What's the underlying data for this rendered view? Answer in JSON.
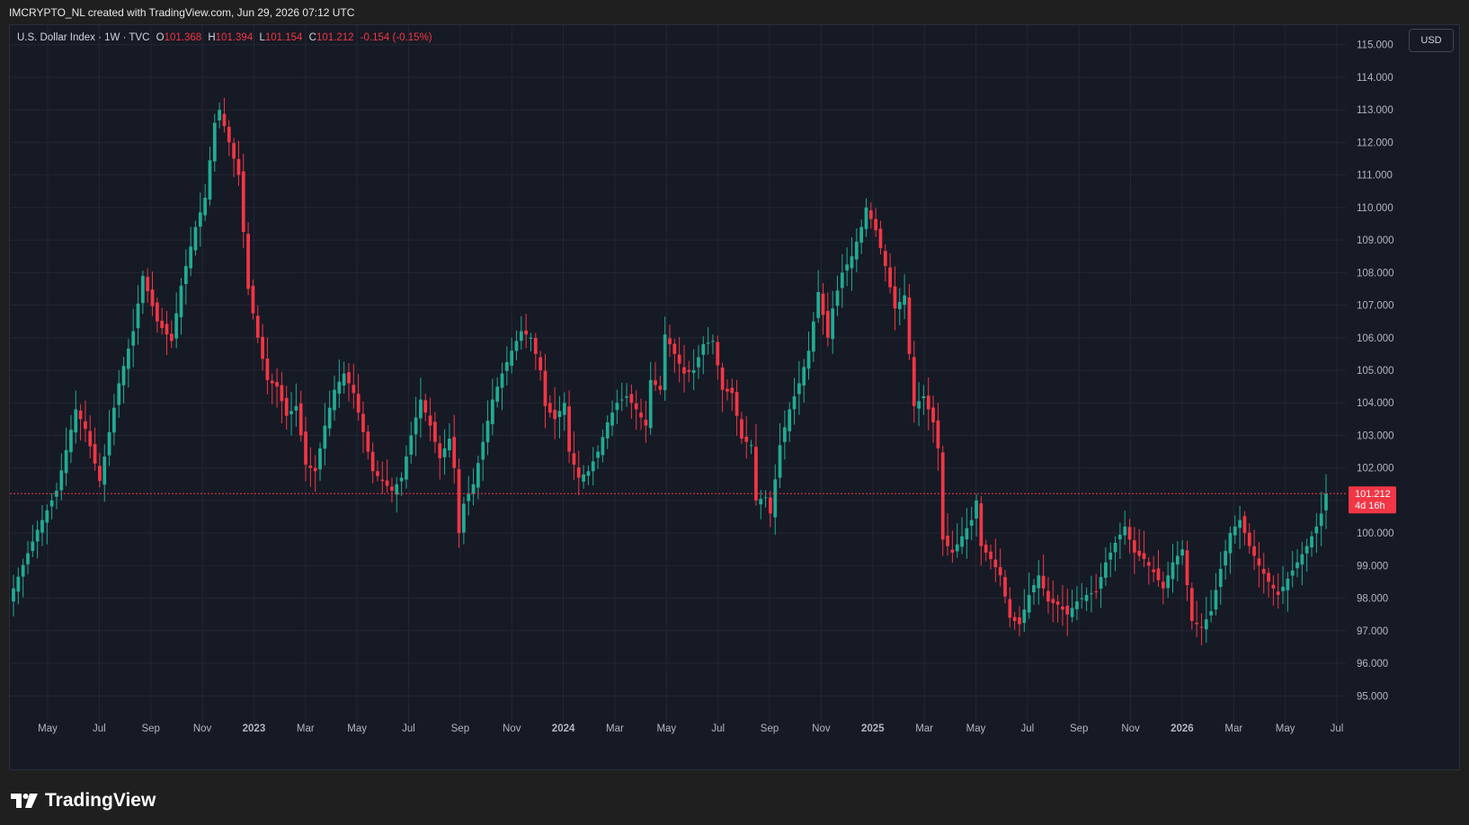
{
  "caption": "IMCRYPTO_NL created with TradingView.com, Jun 29, 2026 07:12 UTC",
  "legend": {
    "symbol": "U.S. Dollar Index · 1W · TVC",
    "open_label": "O",
    "open": "101.368",
    "high_label": "H",
    "high": "101.394",
    "low_label": "L",
    "low": "101.154",
    "close_label": "C",
    "close": "101.212",
    "change": "-0.154 (-0.15%)"
  },
  "currency_button": "USD",
  "price_tag": {
    "price": "101.212",
    "countdown": "4d 16h"
  },
  "logo_text": "TradingView",
  "colors": {
    "up": "#22ab94",
    "down": "#f23645",
    "background": "#161a25",
    "grid": "#232734",
    "axis_text": "#b2b5be"
  },
  "icons": {
    "logo": "tradingview-logo-icon"
  },
  "chart_data": {
    "type": "candlestick",
    "interval": "1W",
    "y_range": [
      94.4,
      115.6
    ],
    "y_ticks": [
      "95.000",
      "96.000",
      "97.000",
      "98.000",
      "99.000",
      "100.000",
      "101.000",
      "102.000",
      "103.000",
      "104.000",
      "105.000",
      "106.000",
      "107.000",
      "108.000",
      "109.000",
      "110.000",
      "111.000",
      "112.000",
      "113.000",
      "114.000",
      "115.000"
    ],
    "x_ticks": [
      "May",
      "Jul",
      "Sep",
      "Nov",
      "2023",
      "Mar",
      "May",
      "Jul",
      "Sep",
      "Nov",
      "2024",
      "Mar",
      "May",
      "Jul",
      "Sep",
      "Nov",
      "2025",
      "Mar",
      "May",
      "Jul",
      "Sep",
      "Nov",
      "2026",
      "Mar",
      "May",
      "Jul"
    ],
    "bold_ticks": [
      "2023",
      "2024",
      "2025",
      "2026"
    ],
    "current_price": 101.212,
    "close_path": [
      [
        0,
        98.3
      ],
      [
        5,
        100.1
      ],
      [
        9,
        101.3
      ],
      [
        13,
        103.8
      ],
      [
        15,
        103.2
      ],
      [
        18,
        101.6
      ],
      [
        22,
        104.6
      ],
      [
        25,
        106.2
      ],
      [
        27,
        107.9
      ],
      [
        30,
        106.5
      ],
      [
        33,
        105.9
      ],
      [
        35,
        107.6
      ],
      [
        38,
        109.4
      ],
      [
        40,
        110.3
      ],
      [
        42,
        112.6
      ],
      [
        43,
        113.0
      ],
      [
        45,
        112.0
      ],
      [
        47,
        111.0
      ],
      [
        49,
        107.5
      ],
      [
        51,
        106.0
      ],
      [
        53,
        104.7
      ],
      [
        55,
        104.5
      ],
      [
        57,
        103.6
      ],
      [
        59,
        103.9
      ],
      [
        61,
        102.1
      ],
      [
        63,
        101.9
      ],
      [
        65,
        103.3
      ],
      [
        67,
        104.4
      ],
      [
        69,
        104.9
      ],
      [
        71,
        104.3
      ],
      [
        73,
        103.1
      ],
      [
        75,
        101.9
      ],
      [
        77,
        101.6
      ],
      [
        79,
        101.3
      ],
      [
        81,
        101.7
      ],
      [
        83,
        103.0
      ],
      [
        85,
        104.1
      ],
      [
        87,
        103.3
      ],
      [
        89,
        102.3
      ],
      [
        91,
        102.9
      ],
      [
        92,
        102.0
      ],
      [
        93,
        100.0
      ],
      [
        94,
        100.9
      ],
      [
        96,
        101.5
      ],
      [
        98,
        102.8
      ],
      [
        100,
        104.1
      ],
      [
        102,
        104.9
      ],
      [
        104,
        105.6
      ],
      [
        106,
        106.2
      ],
      [
        108,
        106.0
      ],
      [
        110,
        105.0
      ],
      [
        111,
        103.9
      ],
      [
        113,
        103.5
      ],
      [
        115,
        104.0
      ],
      [
        116,
        102.5
      ],
      [
        118,
        101.7
      ],
      [
        120,
        101.9
      ],
      [
        122,
        102.5
      ],
      [
        124,
        103.4
      ],
      [
        126,
        104.0
      ],
      [
        128,
        104.2
      ],
      [
        130,
        103.8
      ],
      [
        132,
        103.3
      ],
      [
        133,
        104.7
      ],
      [
        135,
        104.4
      ],
      [
        136,
        106.1
      ],
      [
        138,
        105.5
      ],
      [
        140,
        104.9
      ],
      [
        142,
        105.0
      ],
      [
        144,
        105.8
      ],
      [
        146,
        105.9
      ],
      [
        148,
        104.4
      ],
      [
        150,
        104.3
      ],
      [
        152,
        102.9
      ],
      [
        154,
        102.7
      ],
      [
        155,
        101.0
      ],
      [
        157,
        101.1
      ],
      [
        158,
        100.6
      ],
      [
        160,
        102.7
      ],
      [
        162,
        103.8
      ],
      [
        164,
        104.6
      ],
      [
        166,
        105.6
      ],
      [
        168,
        107.4
      ],
      [
        170,
        106.0
      ],
      [
        171,
        106.9
      ],
      [
        173,
        108.0
      ],
      [
        175,
        108.5
      ],
      [
        177,
        109.4
      ],
      [
        178,
        110.0
      ],
      [
        180,
        109.3
      ],
      [
        182,
        108.2
      ],
      [
        184,
        106.9
      ],
      [
        186,
        107.3
      ],
      [
        187,
        105.5
      ],
      [
        188,
        103.9
      ],
      [
        190,
        104.2
      ],
      [
        192,
        103.4
      ],
      [
        193,
        102.6
      ],
      [
        194,
        99.8
      ],
      [
        196,
        99.4
      ],
      [
        198,
        99.9
      ],
      [
        200,
        100.4
      ],
      [
        201,
        101.0
      ],
      [
        202,
        99.6
      ],
      [
        204,
        99.2
      ],
      [
        206,
        98.7
      ],
      [
        208,
        97.4
      ],
      [
        210,
        97.2
      ],
      [
        212,
        98.1
      ],
      [
        214,
        98.7
      ],
      [
        216,
        97.9
      ],
      [
        218,
        97.8
      ],
      [
        220,
        97.5
      ],
      [
        222,
        97.9
      ],
      [
        224,
        98.1
      ],
      [
        226,
        98.2
      ],
      [
        228,
        99.1
      ],
      [
        230,
        99.7
      ],
      [
        232,
        100.2
      ],
      [
        234,
        99.4
      ],
      [
        236,
        99.2
      ],
      [
        238,
        98.8
      ],
      [
        240,
        98.3
      ],
      [
        242,
        99.1
      ],
      [
        244,
        99.5
      ],
      [
        246,
        97.3
      ],
      [
        248,
        97.1
      ],
      [
        250,
        97.6
      ],
      [
        252,
        98.9
      ],
      [
        254,
        100.0
      ],
      [
        256,
        100.4
      ],
      [
        258,
        99.6
      ],
      [
        260,
        99.0
      ],
      [
        262,
        98.5
      ],
      [
        264,
        98.1
      ],
      [
        266,
        98.6
      ],
      [
        268,
        99.1
      ],
      [
        270,
        99.6
      ],
      [
        272,
        100.2
      ],
      [
        273,
        100.6
      ],
      [
        274,
        101.212
      ]
    ]
  }
}
